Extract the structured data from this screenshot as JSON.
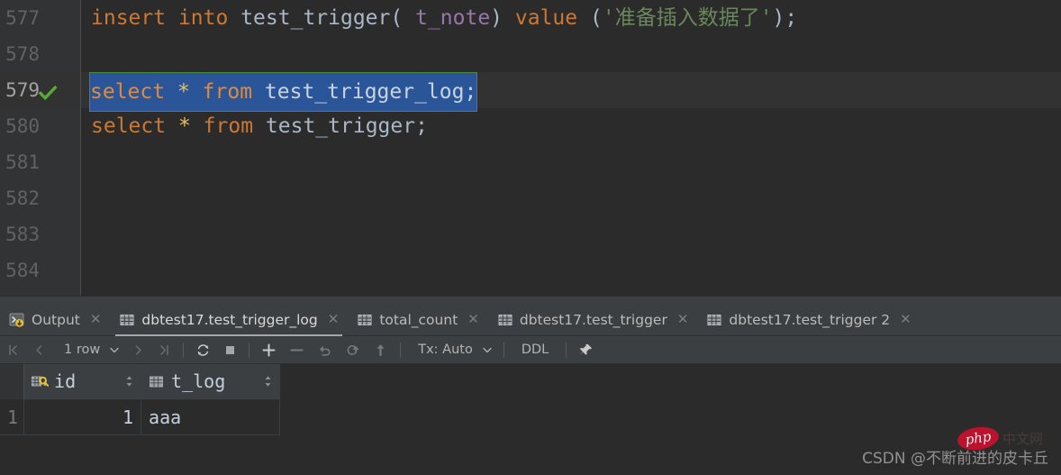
{
  "editor": {
    "lines": [
      {
        "number": "577",
        "status": "",
        "current": false,
        "tokens": [
          {
            "t": "insert",
            "c": "kw"
          },
          {
            "t": " ",
            "c": "pun"
          },
          {
            "t": "into",
            "c": "kw"
          },
          {
            "t": " ",
            "c": "pun"
          },
          {
            "t": "test_trigger(",
            "c": "id"
          },
          {
            "t": " ",
            "c": "pun"
          },
          {
            "t": "t_note",
            "c": "col"
          },
          {
            "t": ")",
            "c": "id"
          },
          {
            "t": " ",
            "c": "pun"
          },
          {
            "t": "value",
            "c": "kw"
          },
          {
            "t": " (",
            "c": "id"
          },
          {
            "t": "'准备插入数据了'",
            "c": "str"
          },
          {
            "t": ");",
            "c": "id"
          }
        ],
        "text": "insert into test_trigger( t_note) value ('准备插入数据了');"
      },
      {
        "number": "578",
        "status": "",
        "current": false,
        "tokens": [],
        "text": ""
      },
      {
        "number": "579",
        "status": "executed-ok",
        "current": true,
        "selected": true,
        "tokens": [
          {
            "t": "select",
            "c": "kw"
          },
          {
            "t": " ",
            "c": "pun"
          },
          {
            "t": "*",
            "c": "op"
          },
          {
            "t": " ",
            "c": "pun"
          },
          {
            "t": "from",
            "c": "kw"
          },
          {
            "t": " ",
            "c": "pun"
          },
          {
            "t": "test_trigger_log",
            "c": "id"
          },
          {
            "t": ";",
            "c": "pun"
          }
        ],
        "text": "select * from test_trigger_log;"
      },
      {
        "number": "580",
        "status": "",
        "current": false,
        "tokens": [
          {
            "t": "select",
            "c": "kw"
          },
          {
            "t": " ",
            "c": "pun"
          },
          {
            "t": "*",
            "c": "op"
          },
          {
            "t": " ",
            "c": "pun"
          },
          {
            "t": "from",
            "c": "kw"
          },
          {
            "t": " ",
            "c": "pun"
          },
          {
            "t": "test_trigger",
            "c": "id"
          },
          {
            "t": ";",
            "c": "pun"
          }
        ],
        "text": "select * from test_trigger;"
      },
      {
        "number": "581",
        "status": "",
        "current": false,
        "tokens": [],
        "text": ""
      },
      {
        "number": "582",
        "status": "",
        "current": false,
        "tokens": [],
        "text": ""
      },
      {
        "number": "583",
        "status": "",
        "current": false,
        "tokens": [],
        "text": ""
      },
      {
        "number": "584",
        "status": "",
        "current": false,
        "tokens": [],
        "text": ""
      }
    ]
  },
  "tabs": [
    {
      "label": "Output",
      "icon": "console-icon",
      "active": false,
      "closable": true
    },
    {
      "label": "dbtest17.test_trigger_log",
      "icon": "table-icon",
      "active": true,
      "closable": true
    },
    {
      "label": "total_count",
      "icon": "table-icon",
      "active": false,
      "closable": true
    },
    {
      "label": "dbtest17.test_trigger",
      "icon": "table-icon",
      "active": false,
      "closable": true
    },
    {
      "label": "dbtest17.test_trigger 2",
      "icon": "table-icon",
      "active": false,
      "closable": true
    }
  ],
  "toolbar": {
    "first_page": "first-page-icon",
    "prev_page": "prev-page-icon",
    "row_count": "1 row",
    "next_page": "next-page-icon",
    "last_page": "last-page-icon",
    "reload": "reload-icon",
    "stop": "stop-icon",
    "add_row": "add-row-icon",
    "delete_row": "delete-row-icon",
    "revert": "revert-icon",
    "rollback": "rollback-icon",
    "submit": "submit-icon",
    "tx_label": "Tx: Auto",
    "ddl_label": "DDL",
    "pin": "pin-icon"
  },
  "result_grid": {
    "columns": [
      {
        "name": "id",
        "icon": "primary-key-icon",
        "align": "right"
      },
      {
        "name": "t_log",
        "icon": "column-icon",
        "align": "left"
      }
    ],
    "rows": [
      {
        "num": "1",
        "cells": [
          "1",
          "aaa"
        ]
      }
    ]
  },
  "watermark": {
    "text": "CSDN @不断前进的皮卡丘",
    "badge": "php",
    "sub": "中文网"
  },
  "colors": {
    "editor_bg": "#2b2b2b",
    "panel_bg": "#3c3f41",
    "gutter_bg": "#313335",
    "keyword": "#cc7832",
    "identifier": "#a9b7c6",
    "column": "#9876aa",
    "string": "#6a8759",
    "operator": "#e8bf6a",
    "selection": "#2a5699",
    "statement_border": "#4a8a3a",
    "check_green": "#59a83a",
    "key_gold": "#e8bf3a",
    "badge_red": "#c8102e"
  }
}
